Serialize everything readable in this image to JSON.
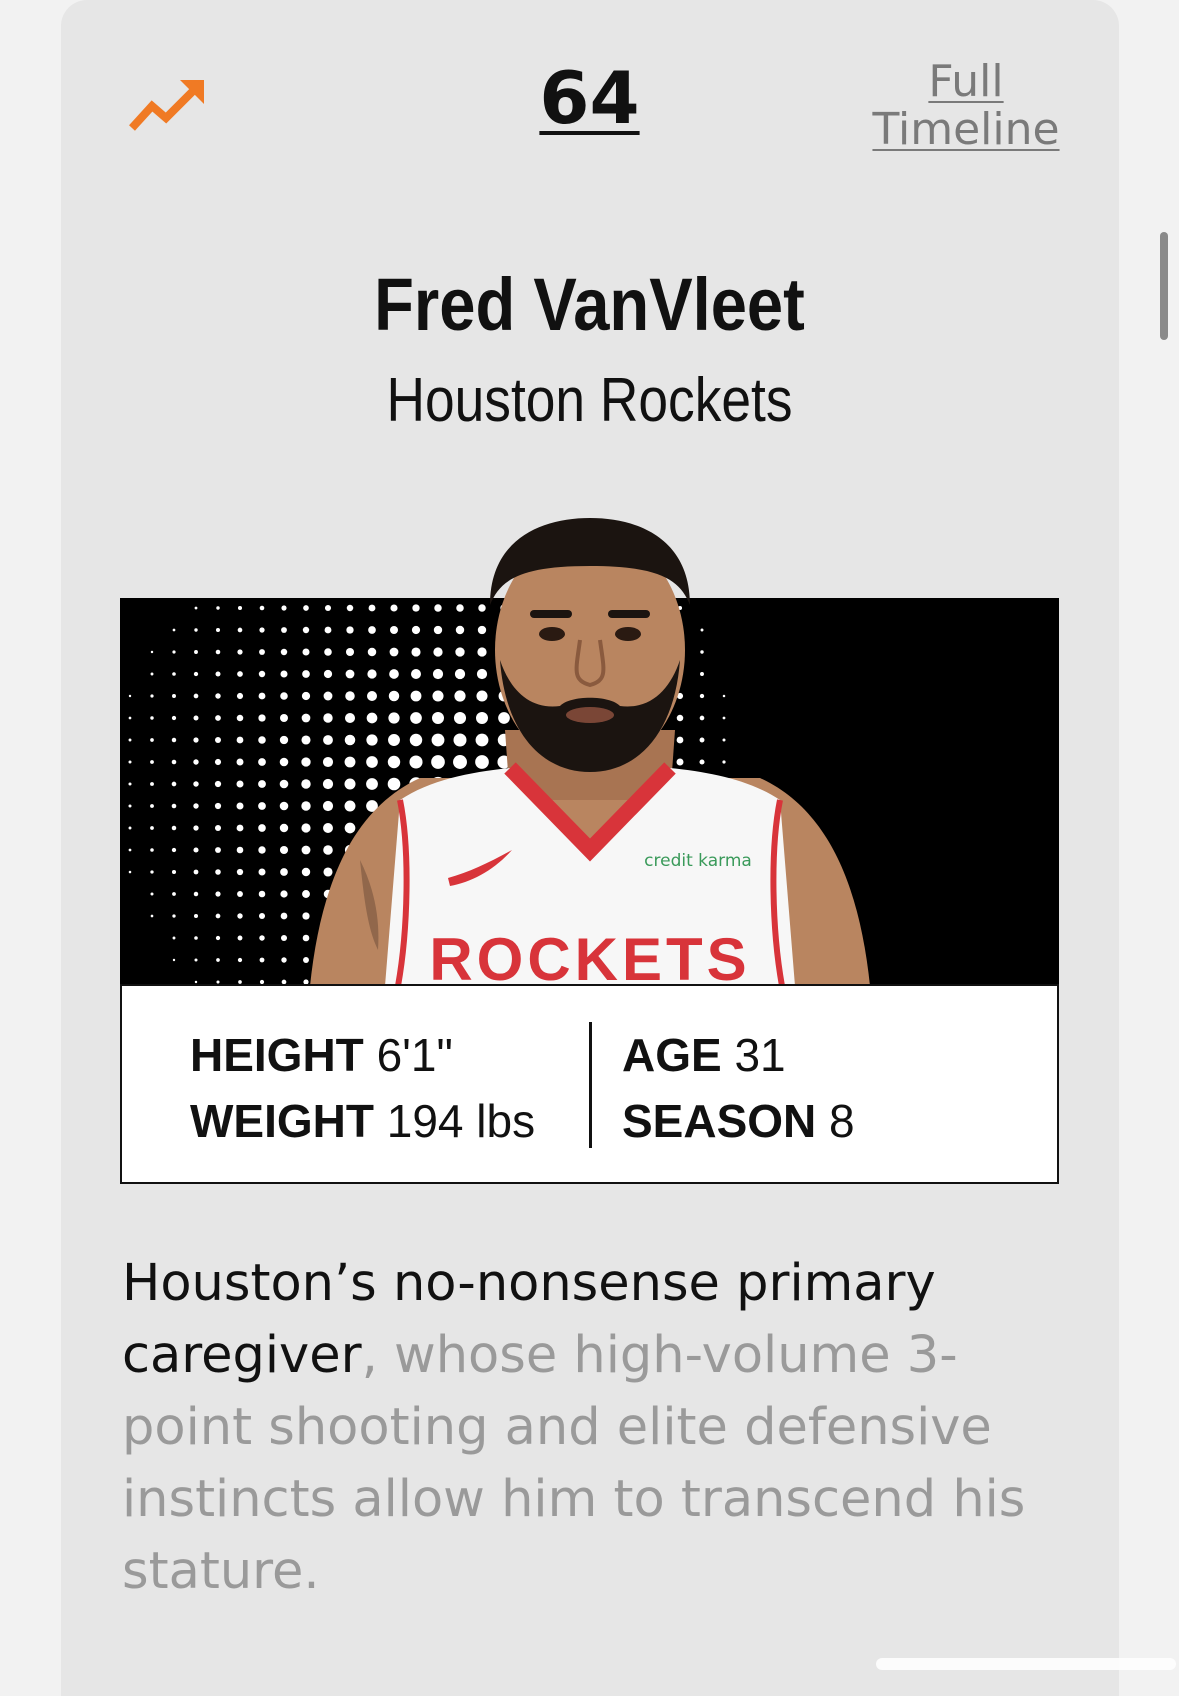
{
  "header": {
    "trend_icon": "trending-up-icon",
    "rank": "64",
    "full_timeline_label": "Full Timeline"
  },
  "player": {
    "name": "Fred VanVleet",
    "team": "Houston Rockets",
    "jersey_text": "ROCKETS",
    "sponsor_text": "credit karma"
  },
  "stats": {
    "height_label": "HEIGHT",
    "height_value": "6'1\"",
    "weight_label": "WEIGHT",
    "weight_value": "194 lbs",
    "age_label": "AGE",
    "age_value": "31",
    "season_label": "SEASON",
    "season_value": "8"
  },
  "blurb": {
    "lead": "Houston’s no-nonsense primary caregiver",
    "rest": ", whose high-volume 3-point shooting and elite defensive instincts allow him to transcend his stature."
  },
  "colors": {
    "accent": "#f07a24",
    "jersey_red": "#d8343a",
    "card_bg": "#e6e6e6",
    "photo_bg": "#000000"
  }
}
